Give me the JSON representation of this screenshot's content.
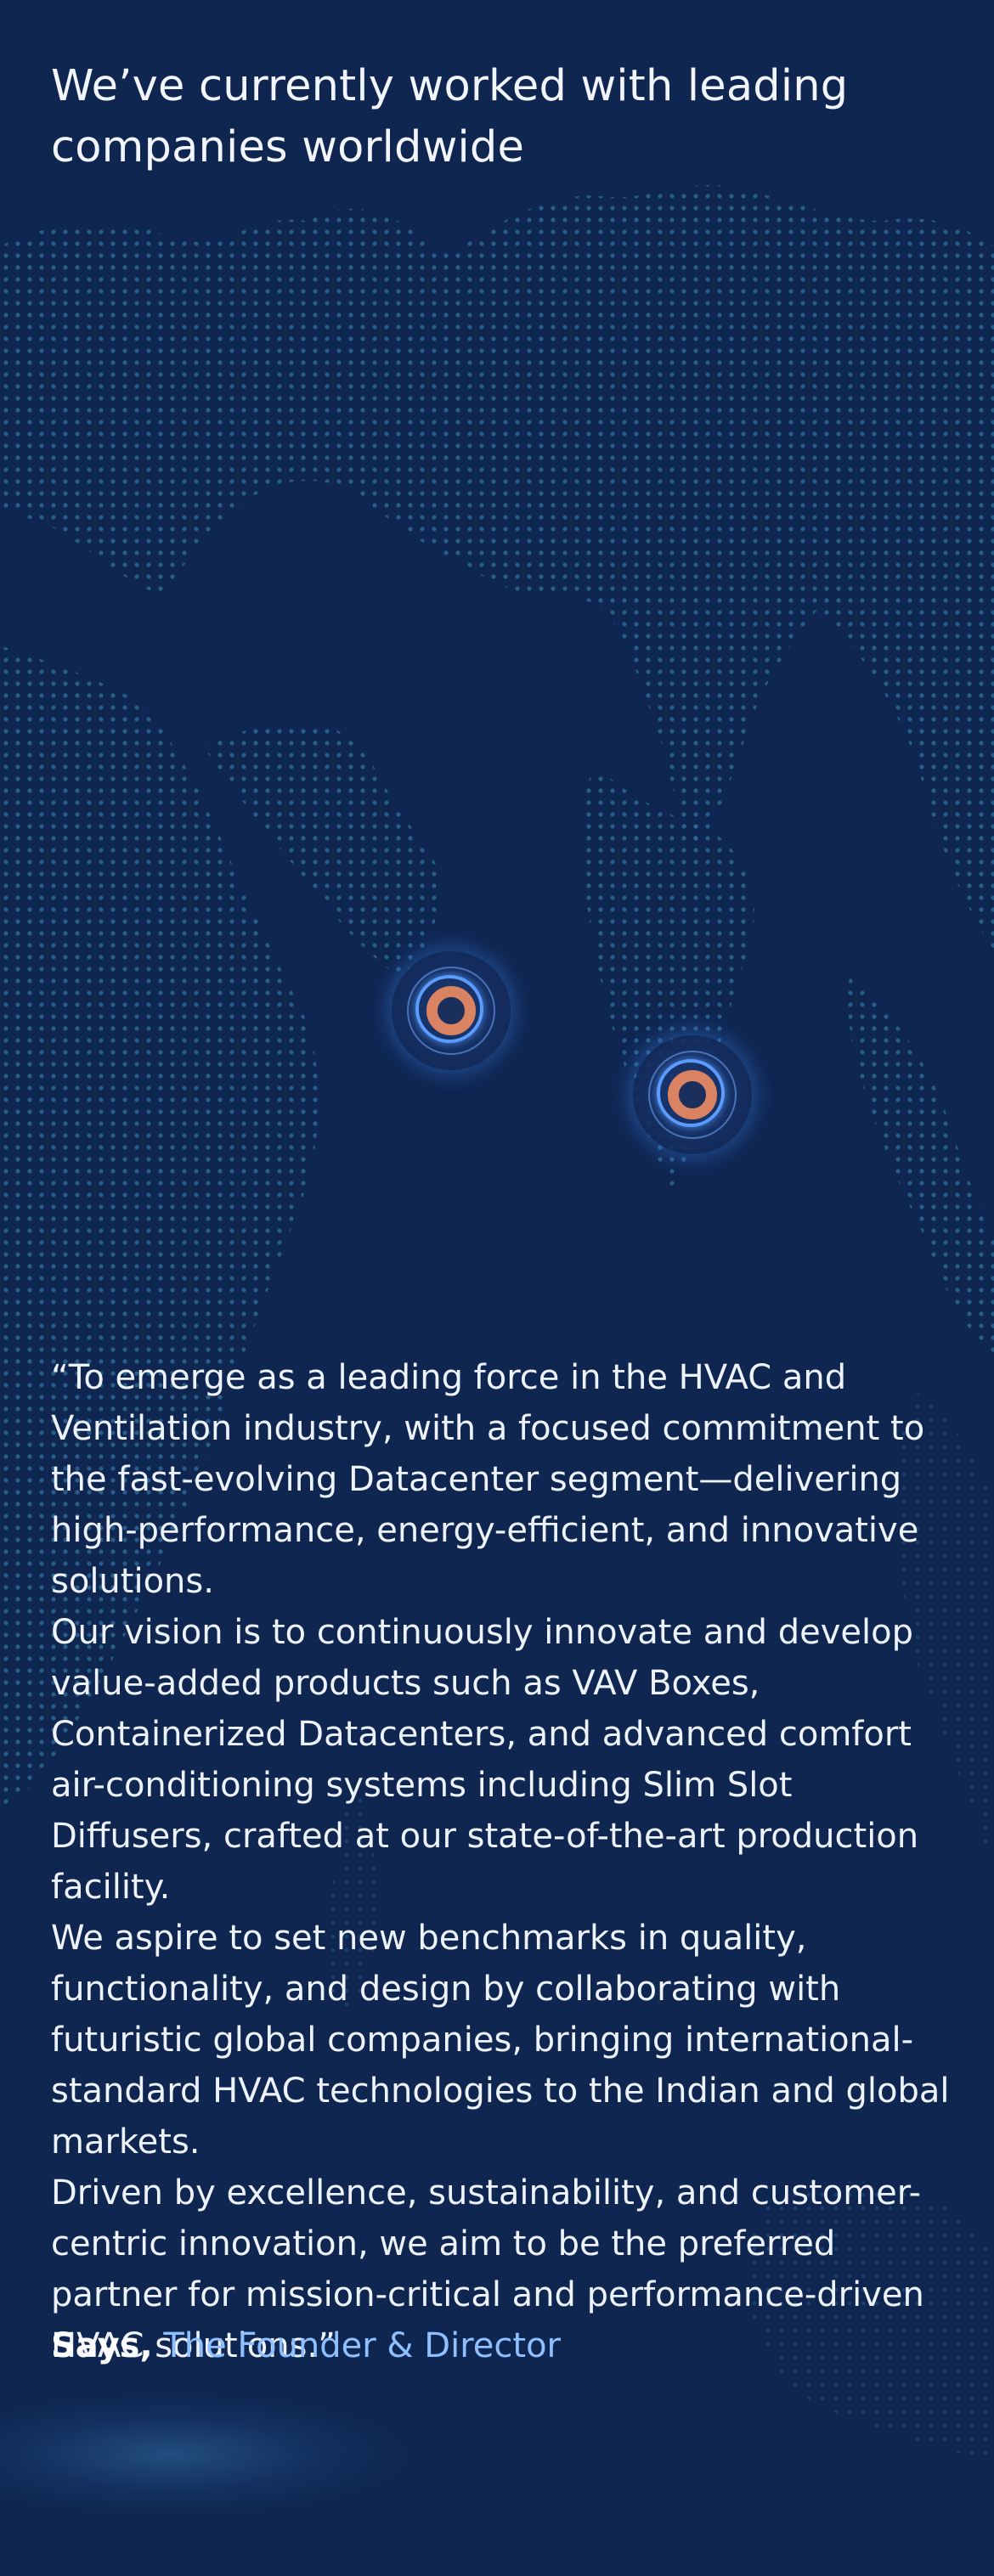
{
  "headline": {
    "line1": "We’ve currently worked with leading",
    "line2": "companies worldwide"
  },
  "map": {
    "background_color": "#0f2651",
    "dot_color": "#2f6f9c",
    "marker_ring_color": "#5b9cff",
    "marker_core_color": "#d98362",
    "markers": [
      {
        "name": "location-marker-1"
      },
      {
        "name": "location-marker-2"
      }
    ]
  },
  "quote": {
    "paragraphs": [
      "“To emerge as a leading force in the HVAC and Ventilation industry, with a focused commitment to the fast-evolving Datacenter segment—delivering high-performance, energy-efficient, and innovative solutions.",
      "Our vision is to continuously innovate and develop value-added products such as VAV Boxes, Containerized Datacenters, and advanced comfort air-conditioning systems including Slim Slot Diffusers, crafted at our state-of-the-art production facility.",
      "We aspire to set new benchmarks in quality, functionality, and design by collaborating with futuristic global companies, bringing international-standard HVAC technologies to the Indian and global markets.",
      "Driven by excellence, sustainability, and customer-centric innovation, we aim to be the preferred partner for mission-critical and performance-driven HVAC solutions.”"
    ]
  },
  "attribution": {
    "prefix": "Says,",
    "role": "The Founder & Director",
    "role_color": "#8ec0ff"
  }
}
